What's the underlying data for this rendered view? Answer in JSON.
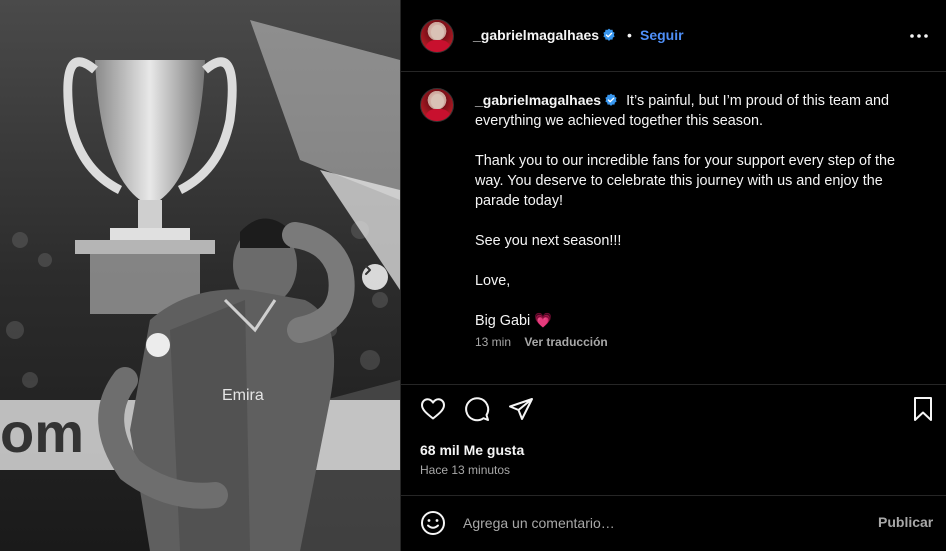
{
  "post": {
    "username": "_gabrielmagalhaes",
    "verified": true,
    "follow_label": "Seguir",
    "separator": "•",
    "more_icon": "more-horizontal-icon",
    "photo_description_icon": "post-photo",
    "carousel_next_icon": "chevron-right-icon"
  },
  "caption": {
    "username": "_gabrielmagalhaes",
    "paragraphs": [
      "It’s painful, but I’m proud of this team and everything we achieved together this season.",
      "Thank you to our incredible fans for your support every step of the way. You deserve to celebrate this journey with us and enjoy the parade today!",
      "See you next season!!!",
      "Love,",
      "Big Gabi"
    ],
    "heart_emoji": "💗",
    "time": "13 min",
    "translate_label": "Ver traducción"
  },
  "actions": {
    "icons": [
      "heart-icon",
      "comment-icon",
      "share-icon",
      "bookmark-icon"
    ],
    "likes": "68 mil Me gusta",
    "time_ago": "Hace 13 minutos"
  },
  "comment": {
    "placeholder": "Agrega un comentario…",
    "publish_label": "Publicar",
    "emoji_icon": "emoji-icon"
  },
  "colors": {
    "background": "#000000",
    "text": "#f5f5f5",
    "secondary_text": "#a8a8a8",
    "link": "#4f8ff7",
    "verified": "#3897f0",
    "border": "#262626"
  }
}
